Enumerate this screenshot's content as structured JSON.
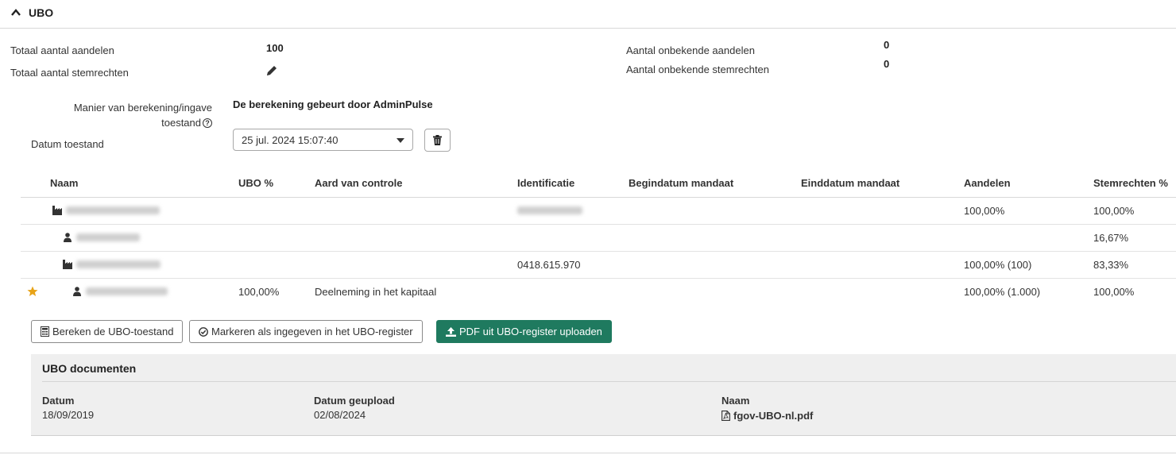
{
  "section": {
    "title": "UBO",
    "toggle_icon": "chevron-up-icon"
  },
  "summary": {
    "total_shares_label": "Totaal aantal aandelen",
    "total_shares_value": "100",
    "total_votes_label": "Totaal aantal stemrechten",
    "unknown_shares_label": "Aantal onbekende aandelen",
    "unknown_shares_value": "0",
    "unknown_votes_label": "Aantal onbekende stemrechten",
    "unknown_votes_value": "0"
  },
  "calc": {
    "label_line1": "Manier van berekening/ingave",
    "label_line2": "toestand",
    "value": "De berekening gebeurt door AdminPulse"
  },
  "state_date": {
    "label": "Datum toestand",
    "selected": "25 jul. 2024 15:07:40"
  },
  "table": {
    "headers": [
      "Naam",
      "UBO %",
      "Aard van controle",
      "Identificatie",
      "Begindatum mandaat",
      "Einddatum mandaat",
      "Aandelen",
      "Stemrechten %"
    ],
    "rows": [
      {
        "type": "company",
        "ubo": "",
        "control": "",
        "id": "",
        "shares": "100,00%",
        "votes": "100,00%"
      },
      {
        "type": "person",
        "ubo": "",
        "control": "",
        "id": "",
        "shares": "",
        "votes": "16,67%"
      },
      {
        "type": "company",
        "ubo": "",
        "control": "",
        "id": "0418.615.970",
        "shares": "100,00% (100)",
        "votes": "83,33%"
      },
      {
        "type": "person",
        "ubo": "100,00%",
        "control": "Deelneming in het kapitaal",
        "id": "",
        "shares": "100,00% (1.000)",
        "votes": "100,00%"
      }
    ]
  },
  "actions": {
    "calculate": "Bereken de UBO-toestand",
    "mark": "Markeren als ingegeven in het UBO-register",
    "upload": "PDF uit UBO-register uploaden"
  },
  "documents": {
    "title": "UBO documenten",
    "headers": {
      "date": "Datum",
      "uploaded": "Datum geupload",
      "name": "Naam"
    },
    "items": [
      {
        "date": "18/09/2019",
        "uploaded": "02/08/2024",
        "name": "fgov-UBO-nl.pdf"
      }
    ]
  },
  "colors": {
    "primary": "#1f7a5f",
    "star": "#e8a317"
  }
}
